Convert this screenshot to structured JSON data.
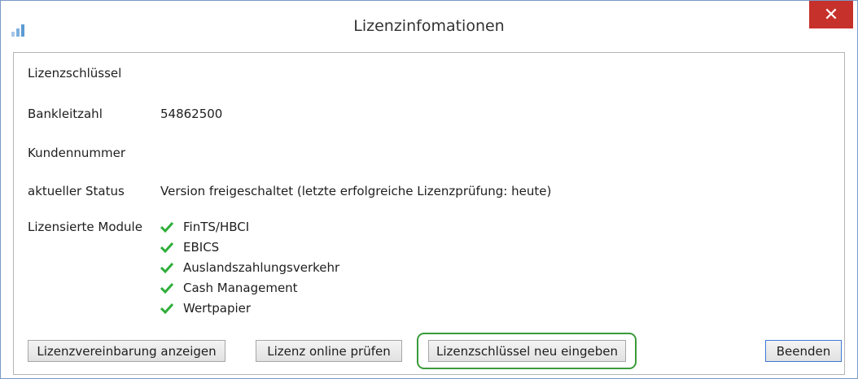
{
  "window": {
    "title": "Lizenzinfomationen",
    "close_label": "✕"
  },
  "fields": {
    "license_key": {
      "label": "Lizenzschlüssel",
      "value": ""
    },
    "bank_code": {
      "label": "Bankleitzahl",
      "value": "54862500"
    },
    "customer_number": {
      "label": "Kundennummer",
      "value": ""
    },
    "status": {
      "label": "aktueller Status",
      "value": "Version freigeschaltet (letzte erfolgreiche Lizenzprüfung: heute)"
    },
    "modules_label": "Lizensierte Module"
  },
  "modules": [
    "FinTS/HBCI",
    "EBICS",
    "Auslandszahlungsverkehr",
    "Cash Management",
    "Wertpapier"
  ],
  "buttons": {
    "agreement": "Lizenzvereinbarung anzeigen",
    "check_online": "Lizenz online prüfen",
    "reenter_key": "Lizenzschlüssel neu eingeben",
    "quit": "Beenden"
  },
  "colors": {
    "check": "#2fae3a",
    "highlight": "#3a9b3a",
    "close": "#c7312b",
    "accent": "#5b9bd5"
  },
  "icons": {
    "app": "bar-chart-icon",
    "check": "checkmark-icon",
    "close": "close-icon"
  }
}
